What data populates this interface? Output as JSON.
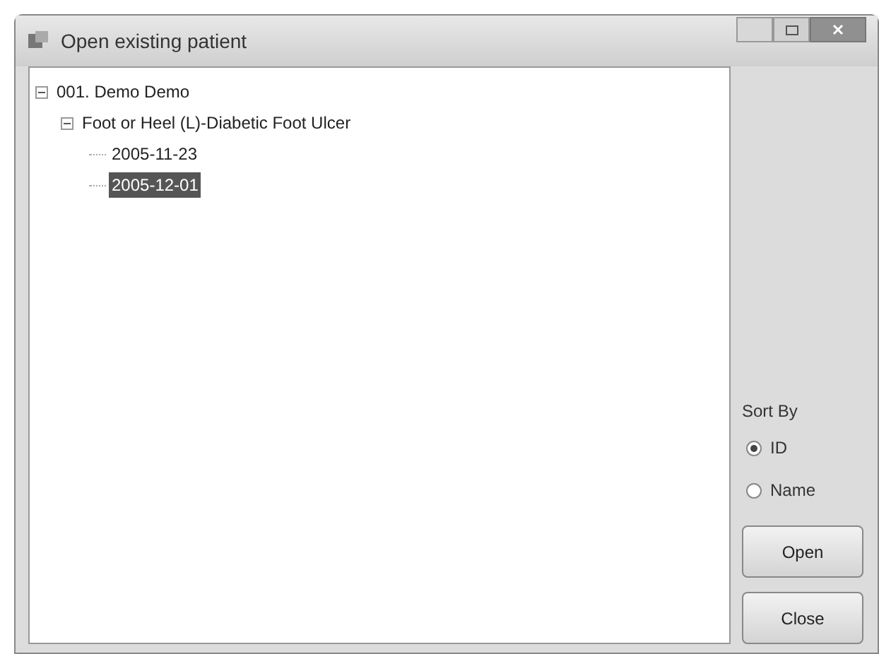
{
  "window": {
    "title": "Open existing patient"
  },
  "tree": [
    {
      "label": "001. Demo Demo",
      "expanded": true,
      "selected": false,
      "children": [
        {
          "label": "Foot or Heel (L)-Diabetic Foot Ulcer",
          "expanded": true,
          "selected": false,
          "children": [
            {
              "label": "2005-11-23",
              "selected": false
            },
            {
              "label": "2005-12-01",
              "selected": true
            }
          ]
        }
      ]
    }
  ],
  "sort_by": {
    "label": "Sort By",
    "options": [
      {
        "label": "ID",
        "selected": true
      },
      {
        "label": "Name",
        "selected": false
      }
    ]
  },
  "buttons": [
    "Open",
    "Close"
  ]
}
